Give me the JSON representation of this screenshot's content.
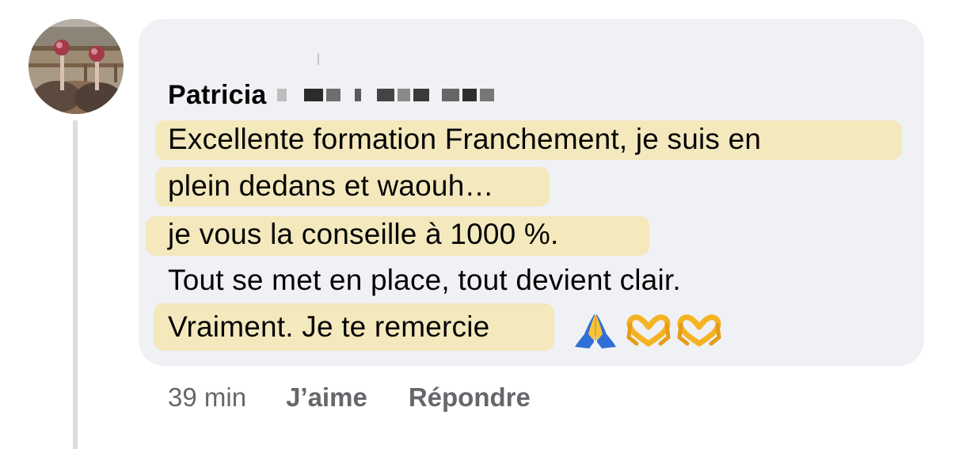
{
  "comment": {
    "author": "Patricia",
    "lines": [
      "Excellente formation Franchement, je suis en",
      "plein dedans et waouh…",
      "je vous la conseille à 1000 %.",
      "Tout se met en place, tout devient clair.",
      "Vraiment. Je te remercie"
    ],
    "emojis": [
      "folded-hands-icon",
      "heart-hands-icon",
      "heart-hands-icon"
    ],
    "highlight_color": "#f4e8bd",
    "bubble_color": "#f0f1f5"
  },
  "actions": {
    "time": "39 min",
    "like": "J’aime",
    "reply": "Répondre"
  }
}
